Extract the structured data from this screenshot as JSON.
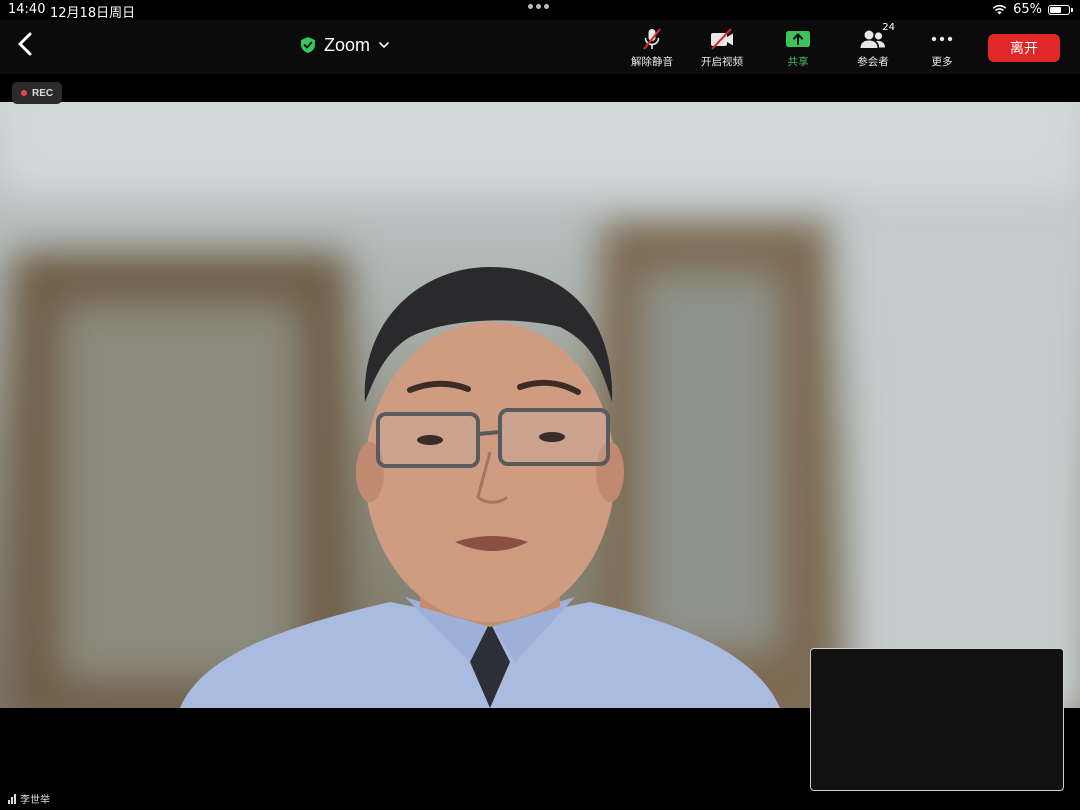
{
  "status_bar": {
    "time": "14:40",
    "date": "12月18日周日",
    "battery_percent": "65%",
    "battery_level": 0.65
  },
  "toolbar": {
    "title": "Zoom",
    "buttons": {
      "unmute": "解除静音",
      "start_video": "开启视频",
      "share": "共享",
      "participants": "参会者",
      "participants_count": "24",
      "more": "更多"
    },
    "leave_label": "离开"
  },
  "recording": {
    "label": "REC"
  },
  "speaker": {
    "name": "李世举"
  },
  "colors": {
    "leave": "#e02828",
    "share_green": "#3ec25a",
    "shield_green": "#34c759"
  },
  "icons": [
    "back-chevron-icon",
    "shield-check-icon",
    "chevron-down-icon",
    "mic-muted-icon",
    "video-off-icon",
    "share-screen-icon",
    "participants-icon",
    "more-icon",
    "wifi-icon",
    "battery-icon",
    "signal-icon"
  ]
}
